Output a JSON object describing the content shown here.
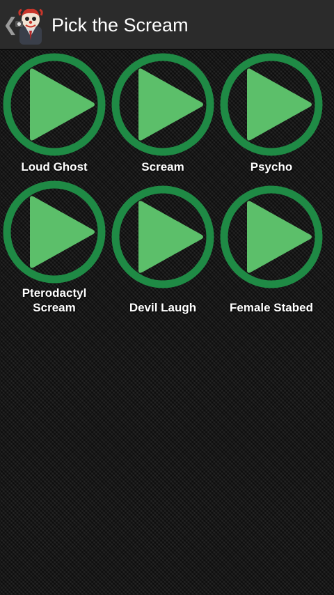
{
  "action_bar": {
    "title": "Pick the Scream",
    "up_icon": "chevron-left-icon",
    "app_icon": "clown-avatar-icon"
  },
  "colors": {
    "ring": "#1f8a45",
    "triangle": "#5cbf6a",
    "action_bar_bg": "#2b2b2b",
    "text": "#ffffff"
  },
  "sounds": [
    {
      "label": "Loud Ghost",
      "icon": "play-icon"
    },
    {
      "label": "Scream",
      "icon": "play-icon"
    },
    {
      "label": "Psycho",
      "icon": "play-icon"
    },
    {
      "label": "Pterodactyl Scream",
      "icon": "play-icon"
    },
    {
      "label": "Devil Laugh",
      "icon": "play-icon"
    },
    {
      "label": "Female Stabed",
      "icon": "play-icon"
    }
  ]
}
